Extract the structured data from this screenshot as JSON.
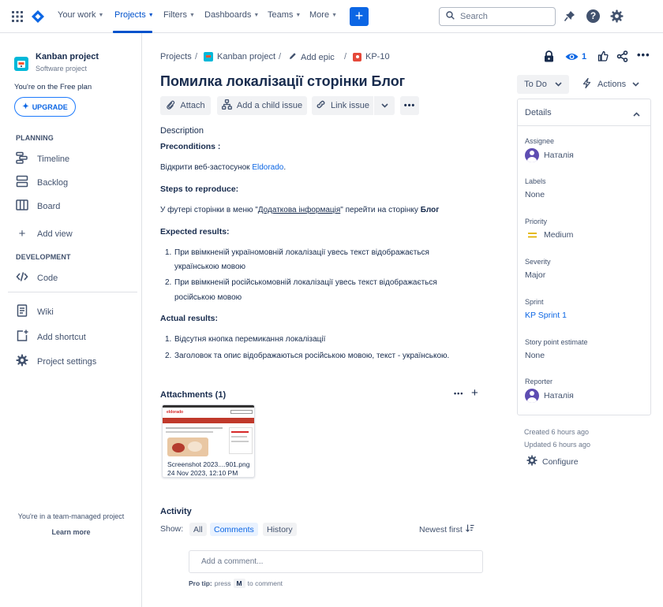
{
  "nav": {
    "your_work": "Your work",
    "projects": "Projects",
    "filters": "Filters",
    "dashboards": "Dashboards",
    "teams": "Teams",
    "more": "More",
    "create_symbol": "+",
    "search_placeholder": "Search",
    "accent_color": "#0052cc"
  },
  "sidebar": {
    "project_name": "Kanban project",
    "project_type": "Software project",
    "plan_text": "You're on the Free plan",
    "upgrade_label": "UPGRADE",
    "planning_header": "PLANNING",
    "planning_items": [
      {
        "label": "Timeline",
        "icon": "timeline-icon"
      },
      {
        "label": "Backlog",
        "icon": "backlog-icon"
      },
      {
        "label": "Board",
        "icon": "board-icon"
      }
    ],
    "add_view": "Add view",
    "development_header": "DEVELOPMENT",
    "code": "Code",
    "wiki": "Wiki",
    "add_shortcut": "Add shortcut",
    "project_settings": "Project settings",
    "team_managed_text": "You're in a team-managed project",
    "learn_more": "Learn more"
  },
  "breadcrumbs": {
    "projects": "Projects",
    "project": "Kanban project",
    "add_epic": "Add epic",
    "issue_key": "KP-10"
  },
  "header_actions": {
    "watchers_count": "1"
  },
  "issue": {
    "title": "Помилка локалізації сторінки Блог",
    "toolbar": {
      "attach": "Attach",
      "add_child": "Add a child issue",
      "link_issue": "Link issue"
    },
    "description_label": "Description",
    "preconditions_heading": "Preconditions :",
    "preconditions_prefix": "Відкрити веб-застосунок ",
    "preconditions_link": "Eldorado",
    "preconditions_suffix": ".",
    "steps_heading": "Steps to reproduce:",
    "steps_prefix": "У футері сторінки в меню \"",
    "steps_link": "Додаткова інформація",
    "steps_middle": "\" перейти на сторінку ",
    "steps_bold": "Блог",
    "expected_heading": "Expected results:",
    "expected_1_line1": "При ввімкненій україномовній локалізації увесь текст відображається",
    "expected_1_line2": "українською мовою",
    "expected_2_line1": "При ввімкненій російськомовній локалізації увесь текст відображається",
    "expected_2_line2": "російською мовою",
    "actual_heading": "Actual results:",
    "actual_1": "Відсутня кнопка перемикання локалізації",
    "actual_2": "Заголовок та опис відображаються російською мовою, текст - українською.",
    "num_1": "1.",
    "num_2": "2."
  },
  "attachments": {
    "heading": "Attachments (1)",
    "file_name": "Screenshot 2023....901.png",
    "file_date": "24 Nov 2023, 12:10 PM",
    "thumb_logo": "eldorado"
  },
  "activity": {
    "heading": "Activity",
    "show_label": "Show:",
    "filter_all": "All",
    "filter_comments": "Comments",
    "filter_history": "History",
    "sort": "Newest first",
    "comment_placeholder": "Add a comment...",
    "protip_prefix": "Pro tip:",
    "protip_press": "press",
    "protip_key": "M",
    "protip_suffix": "to comment"
  },
  "status": {
    "label": "To Do",
    "actions": "Actions"
  },
  "details": {
    "heading": "Details",
    "assignee_label": "Assignee",
    "assignee_value": "Наталія",
    "labels_label": "Labels",
    "labels_value": "None",
    "priority_label": "Priority",
    "priority_value": "Medium",
    "severity_label": "Severity",
    "severity_value": "Major",
    "sprint_label": "Sprint",
    "sprint_value": "KP Sprint 1",
    "estimate_label": "Story point estimate",
    "estimate_value": "None",
    "reporter_label": "Reporter",
    "reporter_value": "Наталія",
    "priority_color": "#e2b203",
    "avatar_color": "#5e4db2"
  },
  "meta": {
    "created": "Created 6 hours ago",
    "updated": "Updated 6 hours ago",
    "configure": "Configure"
  }
}
